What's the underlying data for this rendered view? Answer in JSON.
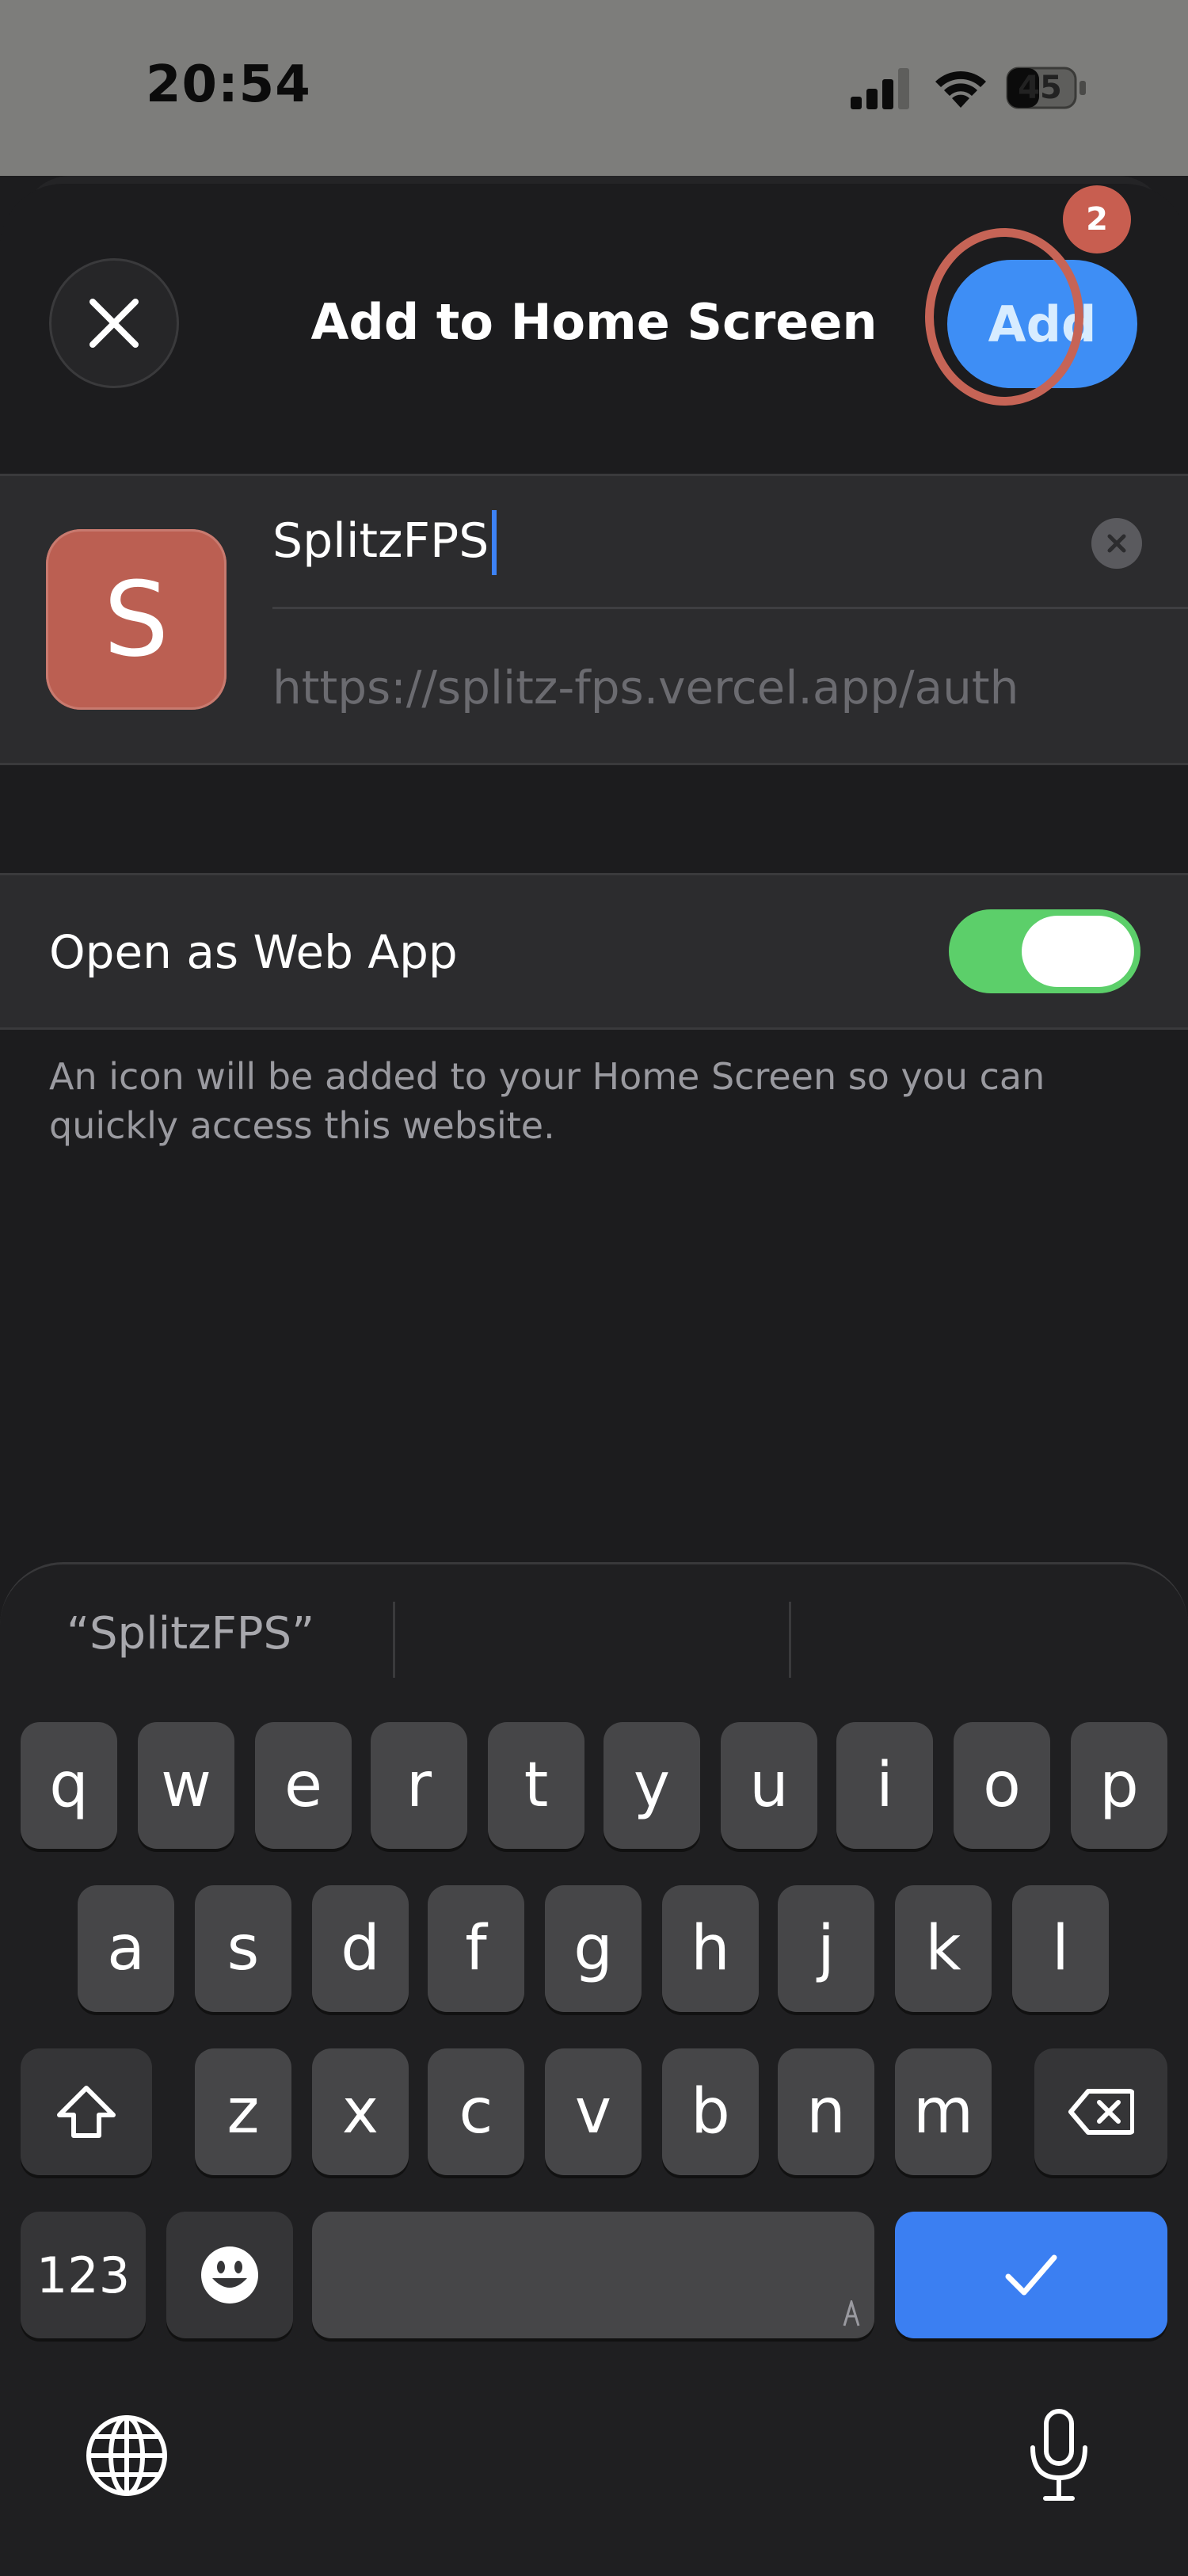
{
  "status_bar": {
    "time": "20:54",
    "battery": "45"
  },
  "sheet": {
    "title": "Add to Home Screen",
    "add_label": "Add",
    "step_badge": "2"
  },
  "bookmark": {
    "icon_letter": "S",
    "icon_color": "#bb5f52",
    "name": "SplitzFPS",
    "url": "https://splitz-fps.vercel.app/auth"
  },
  "web_app": {
    "label": "Open as Web App",
    "enabled": true,
    "hint": "An icon will be added to your Home Screen so you can quickly access this website."
  },
  "keyboard": {
    "suggestion": "“SplitzFPS”",
    "row1": [
      "q",
      "w",
      "e",
      "r",
      "t",
      "y",
      "u",
      "i",
      "o",
      "p"
    ],
    "row2": [
      "a",
      "s",
      "d",
      "f",
      "g",
      "h",
      "j",
      "k",
      "l"
    ],
    "row3": [
      "z",
      "x",
      "c",
      "v",
      "b",
      "n",
      "m"
    ],
    "numbers_label": "123",
    "accent_color": "#3b7ff2"
  }
}
